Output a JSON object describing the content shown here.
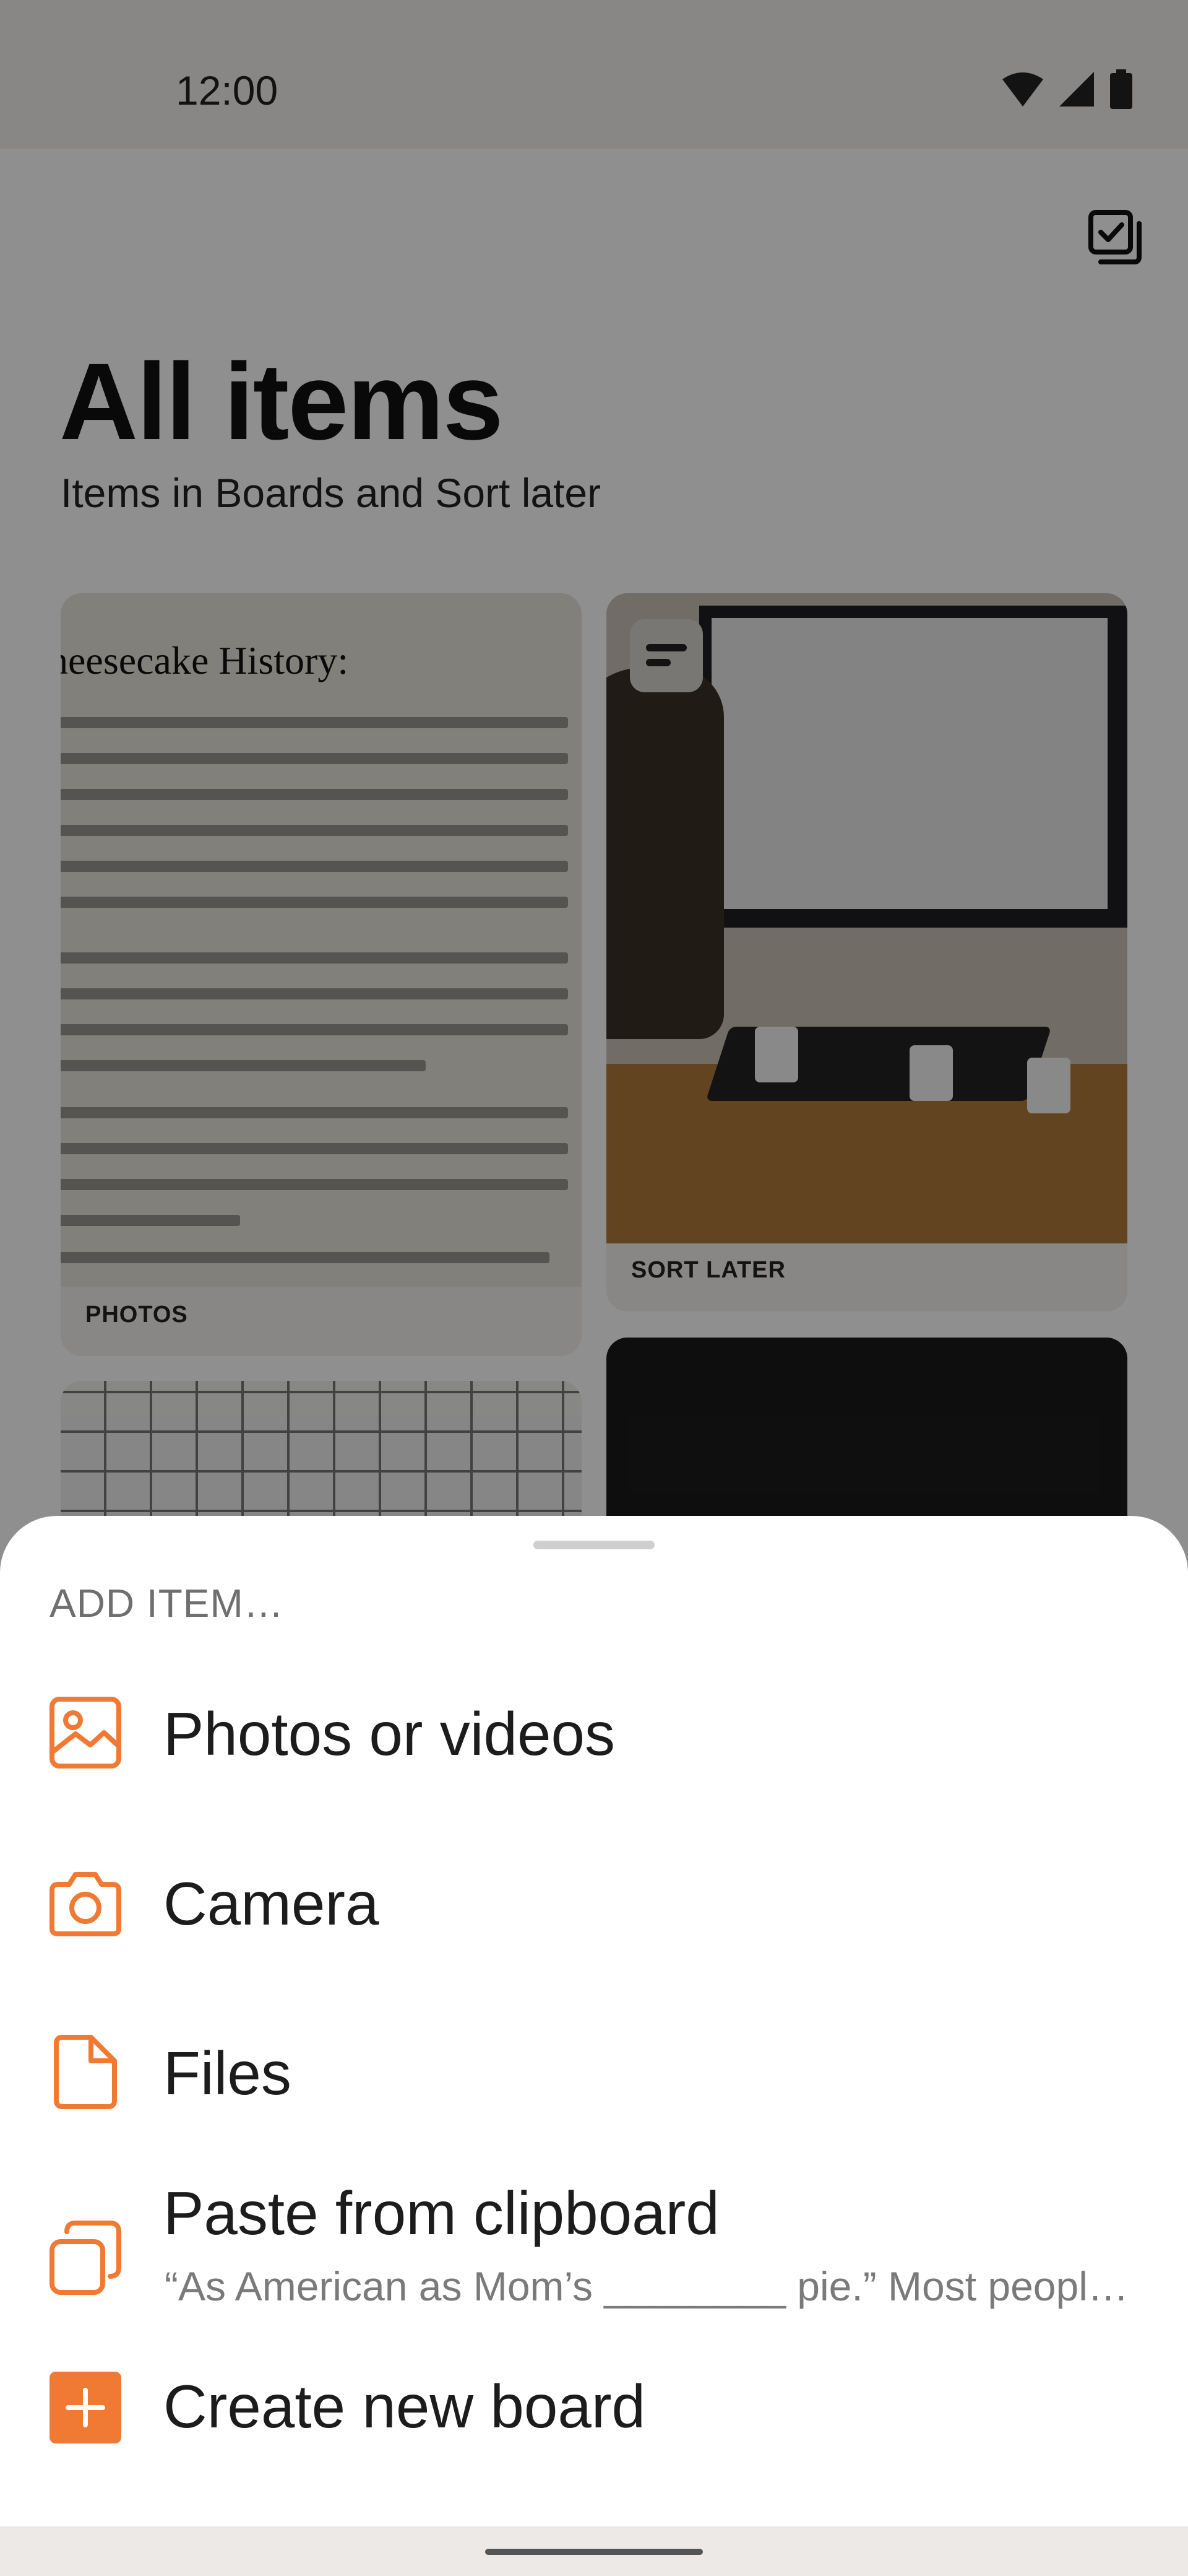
{
  "status_bar": {
    "time": "12:00"
  },
  "header": {
    "title": "All items",
    "subtitle": "Items in Boards and Sort later"
  },
  "cards": [
    {
      "label": "PHOTOS",
      "doc_title": "heesecake History:"
    },
    {
      "label": "SORT LATER"
    }
  ],
  "sheet": {
    "header": "ADD ITEM…",
    "items": [
      {
        "label": "Photos or videos",
        "icon": "image-icon"
      },
      {
        "label": "Camera",
        "icon": "camera-icon"
      },
      {
        "label": "Files",
        "icon": "file-icon"
      },
      {
        "label": "Paste from clipboard",
        "subtitle": "“As American as Mom’s ________ pie.” Most people…",
        "icon": "clipboard-icon"
      },
      {
        "label": "Create new board",
        "icon": "plus-icon"
      }
    ]
  },
  "colors": {
    "accent": "#f07a34",
    "scrim": "rgba(0,0,0,0.44)",
    "sheet_bg": "#ffffff"
  }
}
